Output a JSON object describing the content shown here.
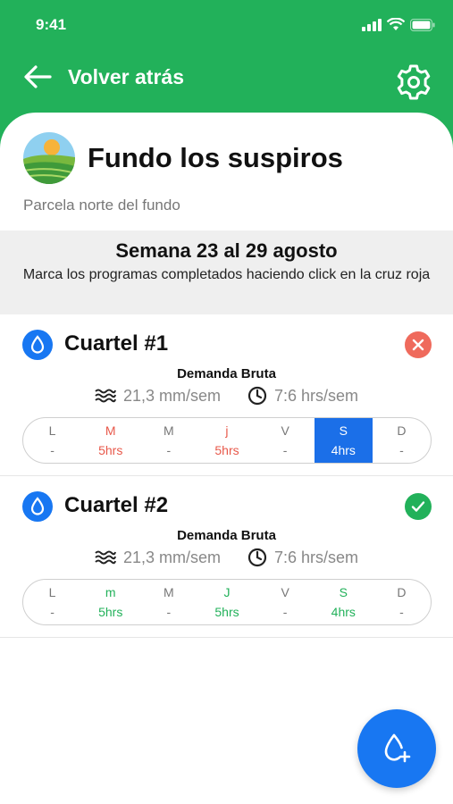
{
  "status_bar": {
    "time": "9:41"
  },
  "nav": {
    "back_label": "Volver atrás"
  },
  "farm": {
    "title": "Fundo los suspiros",
    "subtitle": "Parcela norte del fundo"
  },
  "week": {
    "title": "Semana 23 al 29 agosto",
    "hint": "Marca los programas completados haciendo click en la cruz roja"
  },
  "sectors": [
    {
      "name": "Cuartel #1",
      "status": "pending",
      "demand_label": "Demanda Bruta",
      "water": "21,3 mm/sem",
      "hours": "7:6 hrs/sem",
      "days": [
        {
          "label": "L",
          "value": "-"
        },
        {
          "label": "M",
          "value": "5hrs"
        },
        {
          "label": "M",
          "value": "-"
        },
        {
          "label": "j",
          "value": "5hrs"
        },
        {
          "label": "V",
          "value": "-"
        },
        {
          "label": "S",
          "value": "4hrs"
        },
        {
          "label": "D",
          "value": "-"
        }
      ]
    },
    {
      "name": "Cuartel #2",
      "status": "completed",
      "demand_label": "Demanda Bruta",
      "water": "21,3 mm/sem",
      "hours": "7:6 hrs/sem",
      "days": [
        {
          "label": "L",
          "value": "-"
        },
        {
          "label": "m",
          "value": "5hrs"
        },
        {
          "label": "M",
          "value": "-"
        },
        {
          "label": "J",
          "value": "5hrs"
        },
        {
          "label": "V",
          "value": "-"
        },
        {
          "label": "S",
          "value": "4hrs"
        },
        {
          "label": "D",
          "value": "-"
        }
      ]
    }
  ],
  "colors": {
    "header_green": "#22b15a",
    "primary_blue": "#1877f2",
    "error_red": "#e8594b",
    "success_green": "#22b15a"
  },
  "icons": {
    "back": "arrow-left-icon",
    "settings": "gear-icon",
    "sector": "water-drop-icon",
    "pending": "close-circle-icon",
    "completed": "check-circle-icon",
    "water": "waves-icon",
    "hours": "clock-icon",
    "fab": "add-drop-icon"
  }
}
